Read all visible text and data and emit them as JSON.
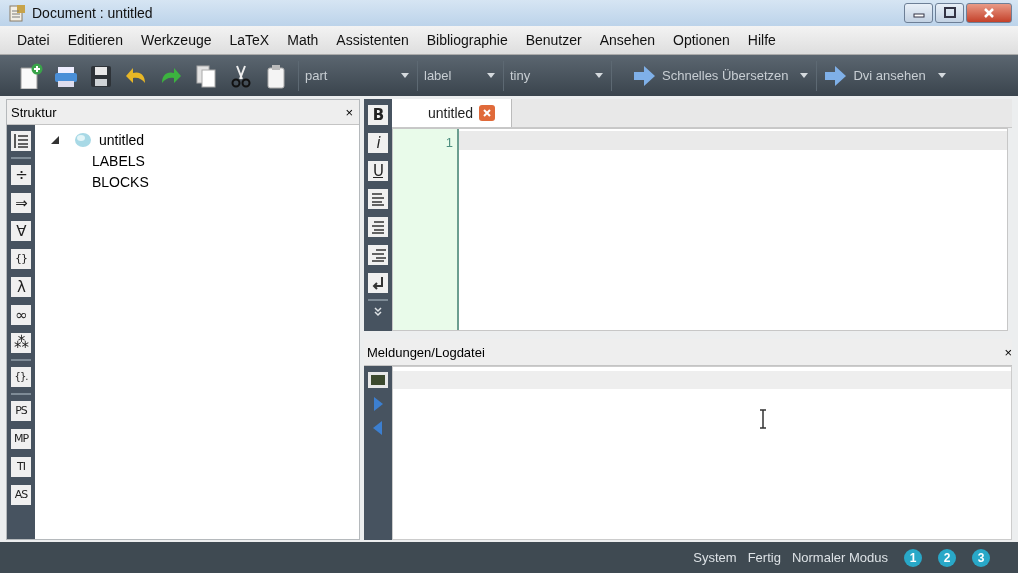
{
  "window": {
    "title": "Document : untitled"
  },
  "menu": [
    "Datei",
    "Editieren",
    "Werkzeuge",
    "LaTeX",
    "Math",
    "Assistenten",
    "Bibliographie",
    "Benutzer",
    "Ansehen",
    "Optionen",
    "Hilfe"
  ],
  "toolbar": {
    "combos": [
      {
        "value": "part"
      },
      {
        "value": "label"
      },
      {
        "value": "tiny"
      }
    ],
    "actions": [
      {
        "label": "Schnelles Übersetzen"
      },
      {
        "label": "Dvi ansehen"
      }
    ]
  },
  "structure": {
    "title": "Struktur",
    "close": "×",
    "tools": [
      {
        "kind": "list"
      },
      {
        "kind": "separator"
      },
      {
        "kind": "glyph",
        "text": "÷"
      },
      {
        "kind": "glyph",
        "text": "⇒"
      },
      {
        "kind": "glyph",
        "text": "∀"
      },
      {
        "kind": "glyph",
        "text": "{}"
      },
      {
        "kind": "glyph",
        "text": "λ"
      },
      {
        "kind": "glyph",
        "text": "∞"
      },
      {
        "kind": "glyph",
        "text": "⁂"
      },
      {
        "kind": "separator"
      },
      {
        "kind": "glyph",
        "text": "{}."
      },
      {
        "kind": "separator"
      },
      {
        "kind": "glyph",
        "text": "PS"
      },
      {
        "kind": "glyph",
        "text": "MP"
      },
      {
        "kind": "glyph",
        "text": "TI"
      },
      {
        "kind": "glyph",
        "text": "AS"
      }
    ],
    "tree": [
      {
        "label": "untitled",
        "expanded": true,
        "children": [
          {
            "label": "LABELS"
          },
          {
            "label": "BLOCKS"
          }
        ]
      }
    ]
  },
  "editor": {
    "tools": [
      {
        "kind": "bold",
        "text": "B"
      },
      {
        "kind": "italic",
        "text": "i"
      },
      {
        "kind": "underline",
        "text": "U"
      },
      {
        "kind": "align-left"
      },
      {
        "kind": "align-center"
      },
      {
        "kind": "align-right"
      },
      {
        "kind": "return"
      },
      {
        "kind": "separator"
      },
      {
        "kind": "more"
      }
    ],
    "tabs": [
      {
        "label": "untitled",
        "selected": true
      }
    ],
    "line_numbers": [
      "1"
    ]
  },
  "log": {
    "title": "Meldungen/Logdatei",
    "close": "×"
  },
  "status_bar": {
    "items": [
      "System",
      "Fertig",
      "Normaler Modus"
    ],
    "views": [
      {
        "label": "1"
      },
      {
        "label": "2"
      },
      {
        "label": "3"
      }
    ]
  }
}
